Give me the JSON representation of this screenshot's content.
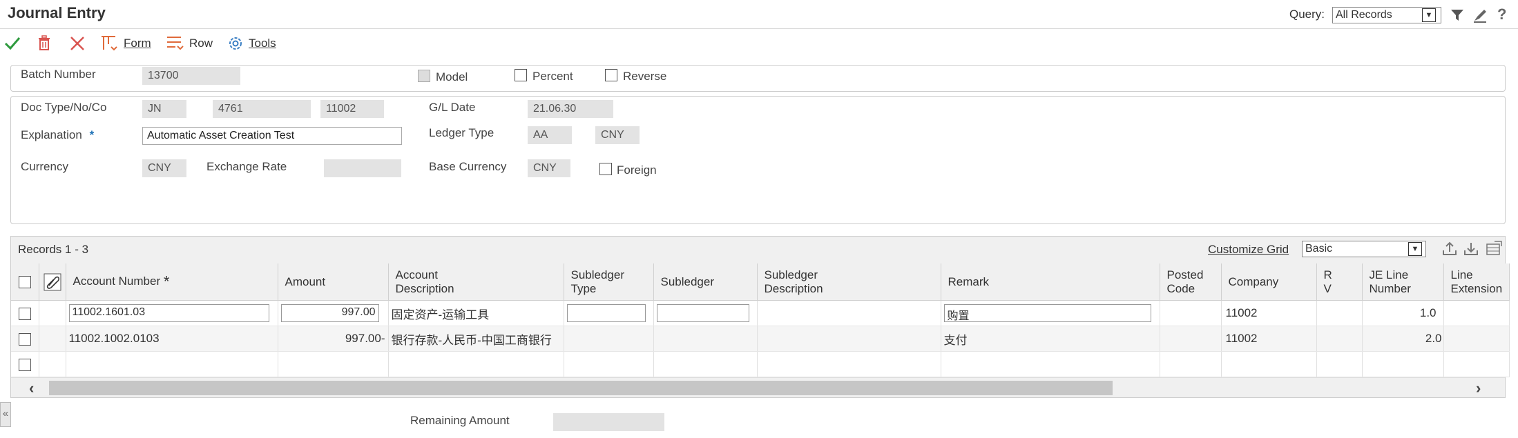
{
  "page": {
    "title": "Journal Entry"
  },
  "query": {
    "label": "Query:",
    "value": "All Records"
  },
  "toolbar": {
    "form_label": "Form",
    "row_label": "Row",
    "tools_label": "Tools"
  },
  "batch": {
    "label": "Batch Number",
    "value": "13700",
    "model_label": "Model",
    "percent_label": "Percent",
    "reverse_label": "Reverse"
  },
  "doc": {
    "doc_label": "Doc Type/No/Co",
    "doc_type": "JN",
    "doc_no": "4761",
    "doc_co": "11002",
    "gl_date_label": "G/L Date",
    "gl_date": "21.06.30",
    "explanation_label": "Explanation",
    "explanation": "Automatic Asset Creation Test",
    "ledger_type_label": "Ledger Type",
    "ledger_type": "AA",
    "ledger_currency": "CNY",
    "currency_label": "Currency",
    "currency": "CNY",
    "exchange_rate_label": "Exchange Rate",
    "exchange_rate": "",
    "base_currency_label": "Base Currency",
    "base_currency": "CNY",
    "foreign_label": "Foreign"
  },
  "grid": {
    "records": "Records 1 - 3",
    "customize_label": "Customize Grid",
    "view": "Basic",
    "columns": {
      "account_number": "Account Number",
      "amount": "Amount",
      "account_desc_1": "Account",
      "account_desc_2": "Description",
      "subledger_type_1": "Subledger",
      "subledger_type_2": "Type",
      "subledger": "Subledger",
      "subledger_desc_1": "Subledger",
      "subledger_desc_2": "Description",
      "remark": "Remark",
      "posted_1": "Posted",
      "posted_2": "Code",
      "company": "Company",
      "rv_1": "R",
      "rv_2": "V",
      "je_1": "JE Line",
      "je_2": "Number",
      "ext_1": "Line",
      "ext_2": "Extension"
    },
    "rows": [
      {
        "account": "11002.1601.03",
        "amount": "997.00",
        "desc": "固定资产-运输工具",
        "remark": "购置",
        "company": "11002",
        "line": "1.0"
      },
      {
        "account": "11002.1002.0103",
        "amount": "997.00-",
        "desc": "银行存款-人民币-中国工商银行",
        "remark": "支付",
        "company": "11002",
        "line": "2.0"
      }
    ]
  },
  "footer": {
    "remaining_label": "Remaining Amount",
    "remaining_value": ""
  },
  "colors": {
    "check": "#2e9a3e",
    "delete": "#d9534f",
    "accent": "#1a6fb5"
  }
}
